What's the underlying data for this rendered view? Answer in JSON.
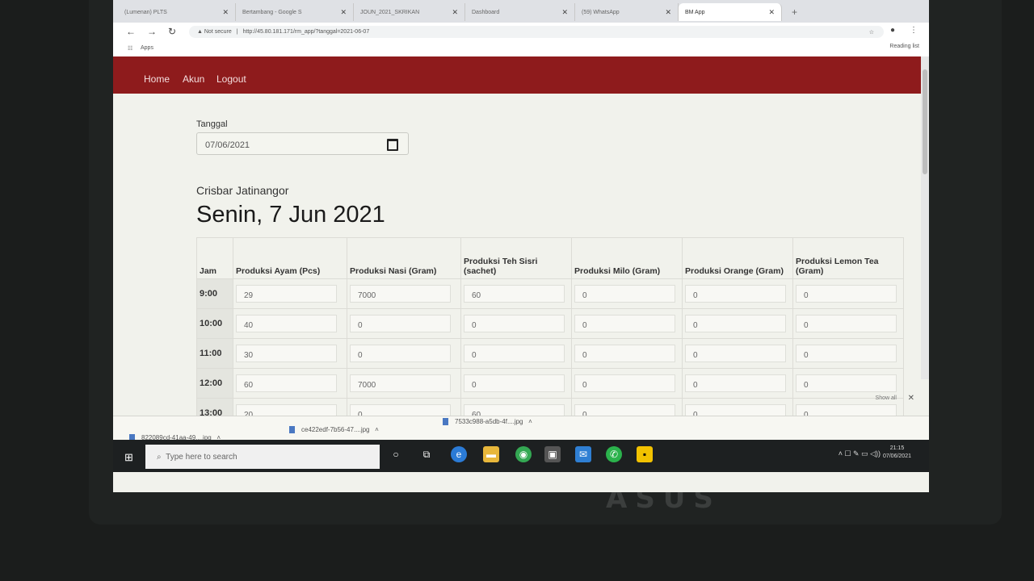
{
  "browser": {
    "tabs": [
      {
        "label": "(Lumenan) PLTS"
      },
      {
        "label": "Bertambang - Google S"
      },
      {
        "label": "JOUN_2021_SKRIKAN"
      },
      {
        "label": "Dashboard"
      },
      {
        "label": "(59) WhatsApp"
      },
      {
        "label": "BM App"
      }
    ],
    "security": "Not secure",
    "url": "http://45.80.181.171/rm_app/?tanggal=2021-06-07",
    "bookmarks_label": "Apps",
    "reading_list": "Reading list"
  },
  "nav": {
    "home": "Home",
    "akun": "Akun",
    "logout": "Logout"
  },
  "form": {
    "date_label": "Tanggal",
    "date_value": "07/06/2021"
  },
  "store_name": "Crisbar Jatinangor",
  "day_title": "Senin, 7 Jun 2021",
  "table": {
    "headers": [
      "Jam",
      "Produksi Ayam (Pcs)",
      "Produksi Nasi (Gram)",
      "Produksi Teh Sisri (sachet)",
      "Produksi Milo (Gram)",
      "Produksi Orange (Gram)",
      "Produksi Lemon Tea (Gram)"
    ],
    "rows": [
      {
        "jam": "9:00",
        "values": [
          "29",
          "7000",
          "60",
          "0",
          "0",
          "0"
        ]
      },
      {
        "jam": "10:00",
        "values": [
          "40",
          "0",
          "0",
          "0",
          "0",
          "0"
        ]
      },
      {
        "jam": "11:00",
        "values": [
          "30",
          "0",
          "0",
          "0",
          "0",
          "0"
        ]
      },
      {
        "jam": "12:00",
        "values": [
          "60",
          "7000",
          "0",
          "0",
          "0",
          "0"
        ]
      },
      {
        "jam": "13:00",
        "values": [
          "20",
          "0",
          "60",
          "0",
          "0",
          "0"
        ]
      }
    ]
  },
  "downloads": {
    "files": [
      "822089cd-41aa-49....jpg",
      "ce422edf-7b56-47....jpg",
      "7533c988-a5db-4f....jpg"
    ],
    "show_all": "Show all"
  },
  "taskbar": {
    "search_placeholder": "Type here to search",
    "time": "21:15",
    "date": "07/06/2021"
  },
  "laptop_brand": "ASUS"
}
